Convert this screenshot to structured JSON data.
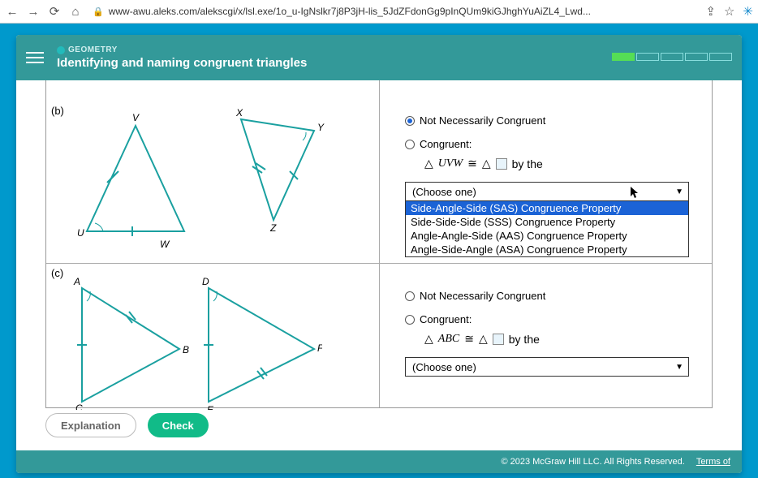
{
  "browser": {
    "url": "www-awu.aleks.com/alekscgi/x/lsl.exe/1o_u-IgNslkr7j8P3jH-lis_5JdZFdonGg9pInQUm9kiGJhghYuAiZL4_Lwd..."
  },
  "header": {
    "category": "GEOMETRY",
    "title": "Identifying and naming congruent triangles"
  },
  "problem_b": {
    "label": "(b)",
    "triangle1": {
      "A": "V",
      "B": "U",
      "C": "W"
    },
    "triangle2": {
      "A": "X",
      "B": "Y",
      "C": "Z"
    },
    "answer": {
      "not_congruent": "Not Necessarily Congruent",
      "congruent": "Congruent:",
      "statement_left": "UVW",
      "by_the": "by the",
      "dropdown_placeholder": "(Choose one)",
      "options": [
        "Side-Angle-Side (SAS) Congruence Property",
        "Side-Side-Side (SSS) Congruence Property",
        "Angle-Angle-Side (AAS) Congruence Property",
        "Angle-Side-Angle (ASA) Congruence Property"
      ],
      "selected_radio": "not_congruent",
      "highlighted_option": 0
    }
  },
  "problem_c": {
    "label": "(c)",
    "triangle1": {
      "A": "A",
      "B": "B",
      "C": "C"
    },
    "triangle2": {
      "A": "D",
      "B": "E",
      "C": "F"
    },
    "answer": {
      "not_congruent": "Not Necessarily Congruent",
      "congruent": "Congruent:",
      "statement_left": "ABC",
      "by_the": "by the",
      "dropdown_placeholder": "(Choose one)"
    }
  },
  "buttons": {
    "explanation": "Explanation",
    "check": "Check"
  },
  "footer": {
    "copyright": "© 2023 McGraw Hill LLC. All Rights Reserved.",
    "terms": "Terms of"
  }
}
